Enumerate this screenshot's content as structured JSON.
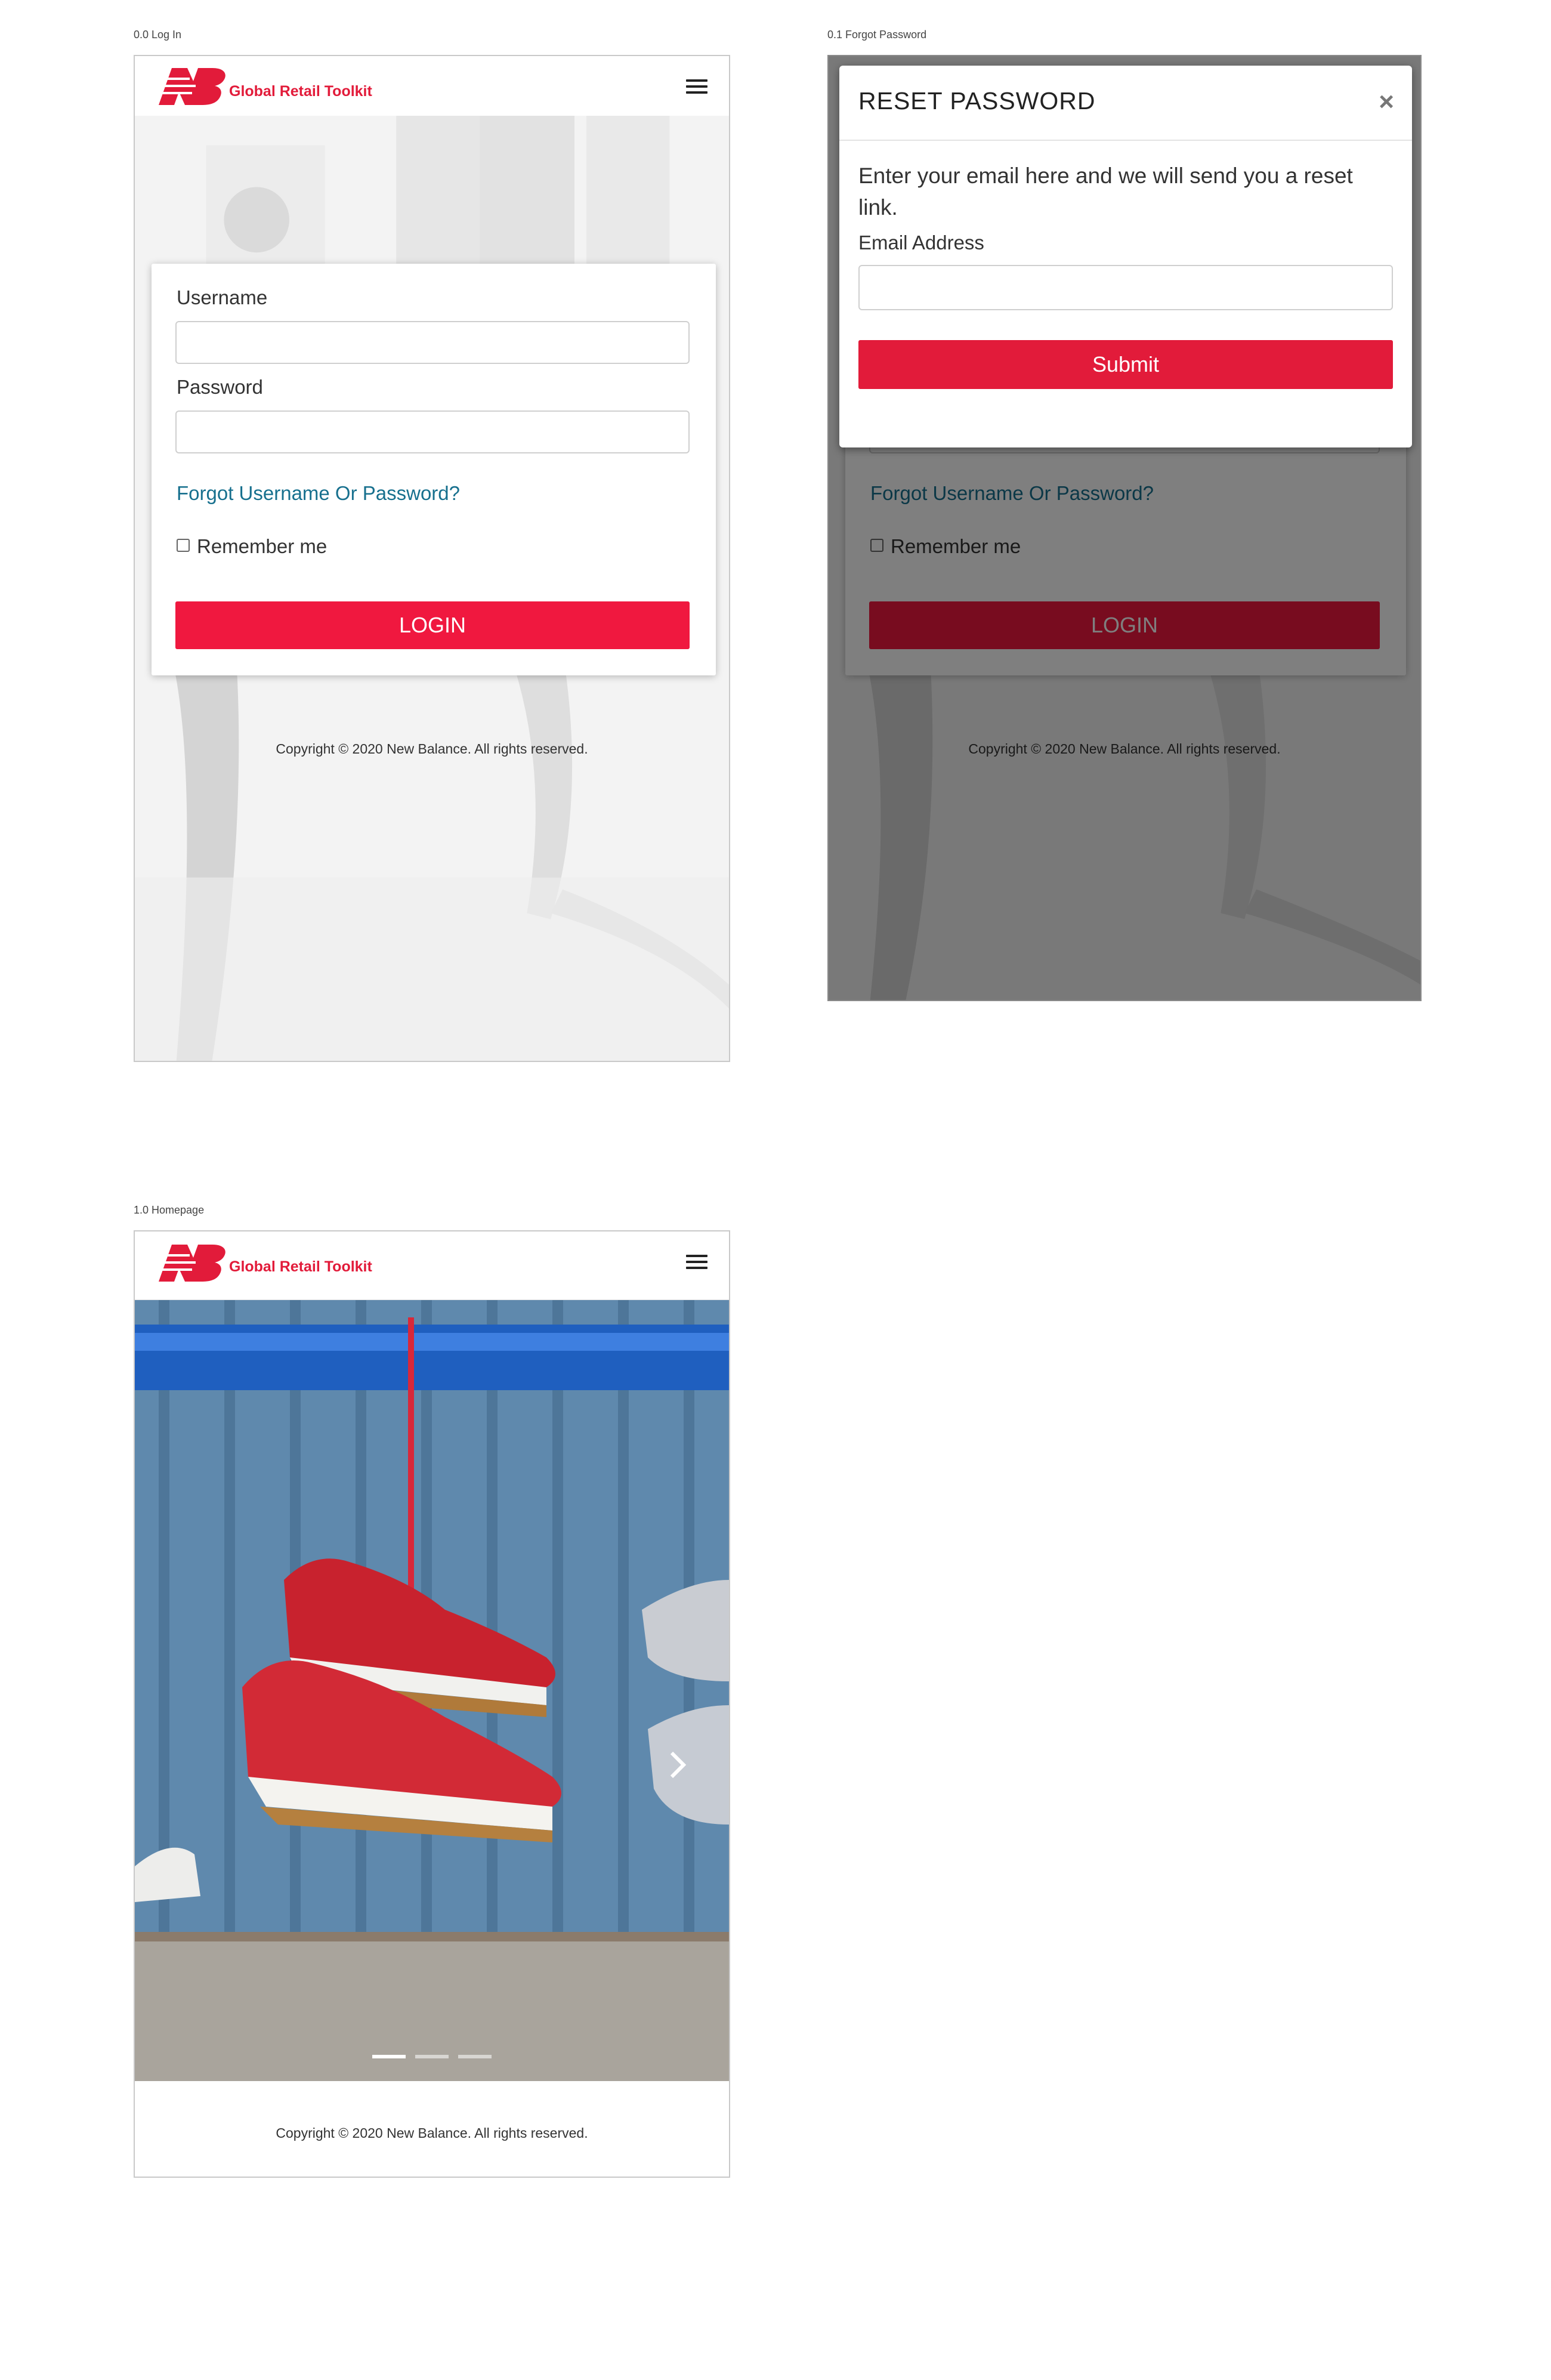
{
  "frames": {
    "login": {
      "caption": "0.0 Log In"
    },
    "forgot": {
      "caption": "0.1 Forgot Password"
    },
    "home": {
      "caption": "1.0 Homepage"
    }
  },
  "header": {
    "brand": "Global Retail Toolkit"
  },
  "login_form": {
    "username_label": "Username",
    "password_label": "Password",
    "forgot_link": "Forgot Username Or Password?",
    "remember_label": "Remember me",
    "login_button": "LOGIN"
  },
  "reset_modal": {
    "title": "RESET PASSWORD",
    "close_glyph": "×",
    "description": "Enter your email here and we will send you a reset link.",
    "email_label": "Email Address",
    "submit_button": "Submit"
  },
  "footer": {
    "copyright": "Copyright © 2020 New Balance. All rights reserved."
  },
  "carousel": {
    "slide_count": 3,
    "active_index": 0
  },
  "colors": {
    "brand_red": "#e21b3a",
    "button_red": "#f0183f",
    "link_teal": "#17708e"
  }
}
